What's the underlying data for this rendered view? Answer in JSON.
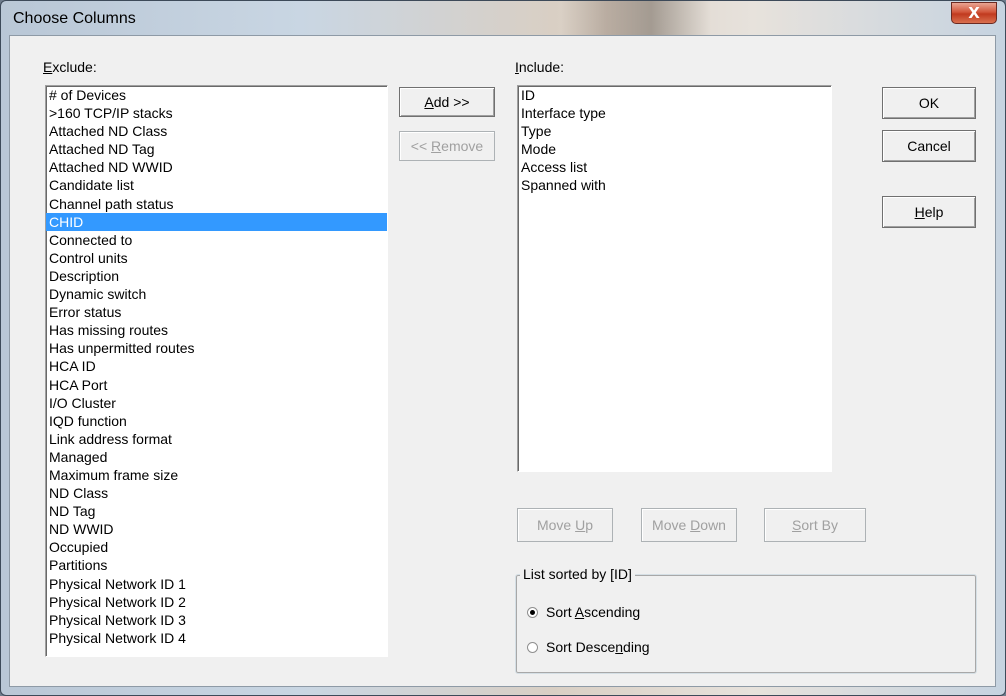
{
  "window": {
    "title": "Choose Columns",
    "close_glyph": "X"
  },
  "exclude": {
    "label_u": "E",
    "label_rest": "xclude:",
    "items": [
      "# of Devices",
      ">160 TCP/IP stacks",
      "Attached ND Class",
      "Attached ND Tag",
      "Attached ND WWID",
      "Candidate list",
      "Channel path status",
      "CHID",
      "Connected to",
      "Control units",
      "Description",
      "Dynamic switch",
      "Error status",
      "Has missing routes",
      "Has unpermitted routes",
      "HCA ID",
      "HCA Port",
      "I/O Cluster",
      "IQD function",
      "Link address format",
      "Managed",
      "Maximum frame size",
      "ND Class",
      "ND Tag",
      "ND WWID",
      "Occupied",
      "Partitions",
      "Physical Network ID 1",
      "Physical Network ID 2",
      "Physical Network ID 3",
      "Physical Network ID 4"
    ],
    "selected": "CHID"
  },
  "include": {
    "label_u": "I",
    "label_rest": "nclude:",
    "items": [
      "ID",
      "Interface type",
      "Type",
      "Mode",
      "Access list",
      "Spanned with"
    ]
  },
  "buttons": {
    "add_u": "A",
    "add_rest": "dd >>",
    "remove_pre": "<< ",
    "remove_u": "R",
    "remove_rest": "emove",
    "ok": "OK",
    "cancel": "Cancel",
    "help_u": "H",
    "help_rest": "elp",
    "move_up_pre": "Move ",
    "move_up_u": "U",
    "move_up_rest": "p",
    "move_down_pre": "Move ",
    "move_down_u": "D",
    "move_down_rest": "own",
    "sort_by_u": "S",
    "sort_by_rest": "ort By"
  },
  "sort_group": {
    "title": "List sorted by  [ID]",
    "asc_pre": "Sort ",
    "asc_u": "A",
    "asc_rest": "scending",
    "desc_pre": "Sort Desce",
    "desc_u": "n",
    "desc_rest": "ding",
    "selected": "ascending"
  },
  "colors": {
    "selection": "#3399ff",
    "close_red": "#c13a1f",
    "disabled_text": "#a0a0a0"
  }
}
